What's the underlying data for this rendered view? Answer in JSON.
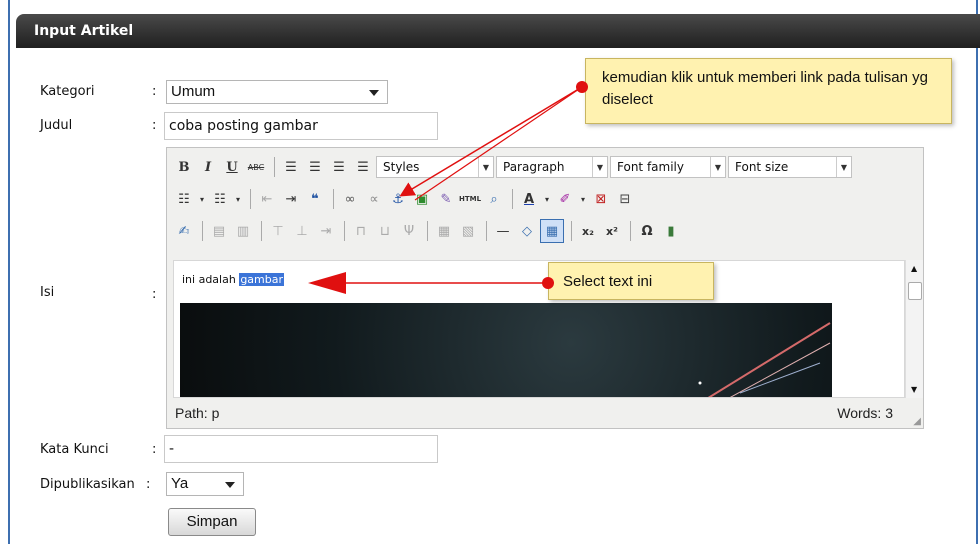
{
  "header": {
    "title": "Input Artikel"
  },
  "form": {
    "kategori_label": "Kategori",
    "kategori_value": "Umum",
    "judul_label": "Judul",
    "judul_value": "coba posting gambar",
    "isi_label": "Isi",
    "kata_kunci_label": "Kata Kunci",
    "kata_kunci_value": "-",
    "dipublikasikan_label": "Dipublikasikan",
    "dipublikasikan_value": "Ya",
    "colon": ":",
    "submit_label": "Simpan"
  },
  "editor": {
    "styles_label": "Styles",
    "paragraph_label": "Paragraph",
    "fontfamily_label": "Font family",
    "fontsize_label": "Font size",
    "content_plain": "ini adalah ",
    "content_selected": "gambar",
    "path_text": "Path: p",
    "words_text": "Words: 3",
    "toolbar_row1": [
      "bold-icon",
      "italic-icon",
      "underline-icon",
      "strikethrough-icon",
      "align-left-icon",
      "align-center-icon",
      "align-right-icon",
      "align-justify-icon"
    ],
    "toolbar_row2": [
      "bullet-list-icon",
      "numbered-list-icon",
      "outdent-icon",
      "indent-icon",
      "blockquote-icon",
      "link-icon",
      "unlink-icon",
      "anchor-icon",
      "image-icon",
      "cleanup-icon",
      "html-icon",
      "preview-icon",
      "font-color-icon",
      "highlight-icon",
      "paste-word-icon",
      "pagebreak-icon"
    ],
    "toolbar_row3": [
      "edit-icon",
      "table-props-icon",
      "row-props-icon",
      "insert-row-icon",
      "delete-row-icon",
      "col-icon",
      "merge-icon",
      "split-icon",
      "table-icon",
      "hr-icon",
      "eraser-icon",
      "visualaid-icon",
      "subscript-icon",
      "superscript-icon",
      "charmap-icon",
      "media-icon"
    ],
    "glyph_bold": "B",
    "glyph_italic": "I",
    "glyph_underline": "U",
    "glyph_strike": "ABC",
    "glyph_html": "HTML",
    "glyph_quote": "❝",
    "glyph_subscript": "x₂",
    "glyph_superscript": "x²",
    "glyph_omega": "Ω"
  },
  "annotations": {
    "link_note": "kemudian klik untuk memberi link pada tulisan yg diselect",
    "select_note": "Select text ini"
  },
  "colors": {
    "header_bg": "#2b2b2b",
    "selection": "#3b74d8",
    "callout_bg": "#fff2b0",
    "arrow": "#e01010",
    "frame_border": "#3d6fb0"
  }
}
